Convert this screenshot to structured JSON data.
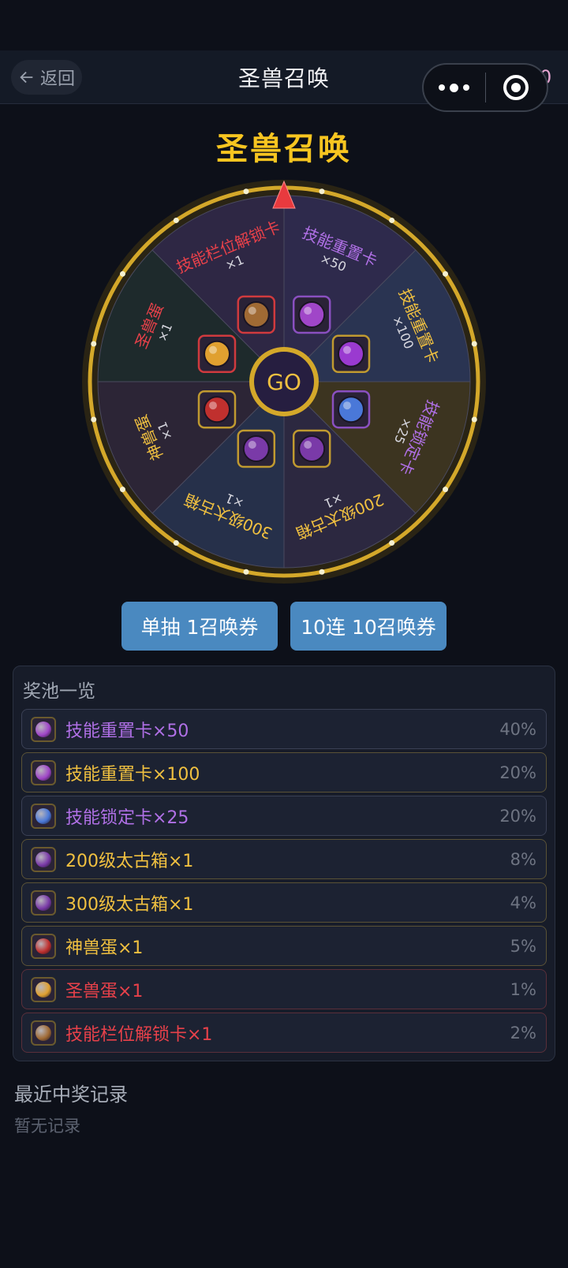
{
  "nav": {
    "back_label": "返回",
    "title": "圣兽召唤",
    "coin_count": "0"
  },
  "heading": "圣兽召唤",
  "wheel": {
    "center_label": "GO",
    "segments": [
      {
        "name": "技能重置卡",
        "qty": "×50",
        "color": "#b070e6",
        "fill": "#2e2a4c",
        "icon": "purple-orb-icon"
      },
      {
        "name": "技能重置卡",
        "qty": "×100",
        "color": "#f0c040",
        "fill": "#2a3452",
        "icon": "purple-cube-icon"
      },
      {
        "name": "技能锁定卡",
        "qty": "×25",
        "color": "#b070e6",
        "fill": "#3c3420",
        "icon": "blue-crystal-icon"
      },
      {
        "name": "200级太古箱",
        "qty": "×1",
        "color": "#f0c040",
        "fill": "#2c2840",
        "icon": "purple-egg-icon"
      },
      {
        "name": "300级太古箱",
        "qty": "×1",
        "color": "#f0c040",
        "fill": "#26304a",
        "icon": "purple-egg-icon"
      },
      {
        "name": "神兽蛋",
        "qty": "×1",
        "color": "#f0c040",
        "fill": "#2c2536",
        "icon": "red-dragon-egg-icon"
      },
      {
        "name": "圣兽蛋",
        "qty": "×1",
        "color": "#e8414a",
        "fill": "#1e2a2c",
        "icon": "golden-egg-icon"
      },
      {
        "name": "技能栏位解锁卡",
        "qty": "×1",
        "color": "#e8414a",
        "fill": "#2e2744",
        "icon": "bronze-scroll-icon"
      }
    ]
  },
  "buttons": {
    "single": "单抽 1召唤券",
    "ten": "10连 10召唤券"
  },
  "pool": {
    "title": "奖池一览",
    "items": [
      {
        "name": "技能重置卡×50",
        "rate": "40%",
        "color": "#b070e6",
        "border": "#3a4054",
        "icon": "purple-orb-icon",
        "icon_color": "#a046c8"
      },
      {
        "name": "技能重置卡×100",
        "rate": "20%",
        "color": "#f0c040",
        "border": "#5a5236",
        "icon": "purple-orb-icon",
        "icon_color": "#a046c8"
      },
      {
        "name": "技能锁定卡×25",
        "rate": "20%",
        "color": "#b070e6",
        "border": "#3a4054",
        "icon": "blue-crystal-icon",
        "icon_color": "#4a78d8"
      },
      {
        "name": "200级太古箱×1",
        "rate": "8%",
        "color": "#f0c040",
        "border": "#5a5236",
        "icon": "purple-egg-icon",
        "icon_color": "#7a3aa8"
      },
      {
        "name": "300级太古箱×1",
        "rate": "4%",
        "color": "#f0c040",
        "border": "#5a5236",
        "icon": "purple-egg-icon",
        "icon_color": "#7a3aa8"
      },
      {
        "name": "神兽蛋×1",
        "rate": "5%",
        "color": "#f0c040",
        "border": "#5a5236",
        "icon": "red-dragon-egg-icon",
        "icon_color": "#c0302e"
      },
      {
        "name": "圣兽蛋×1",
        "rate": "1%",
        "color": "#e8414a",
        "border": "#5a2f3a",
        "icon": "golden-egg-icon",
        "icon_color": "#e0a030"
      },
      {
        "name": "技能栏位解锁卡×1",
        "rate": "2%",
        "color": "#e8414a",
        "border": "#5a2f3a",
        "icon": "bronze-scroll-icon",
        "icon_color": "#a06a34"
      }
    ]
  },
  "records": {
    "title": "最近中奖记录",
    "empty": "暂无记录"
  }
}
